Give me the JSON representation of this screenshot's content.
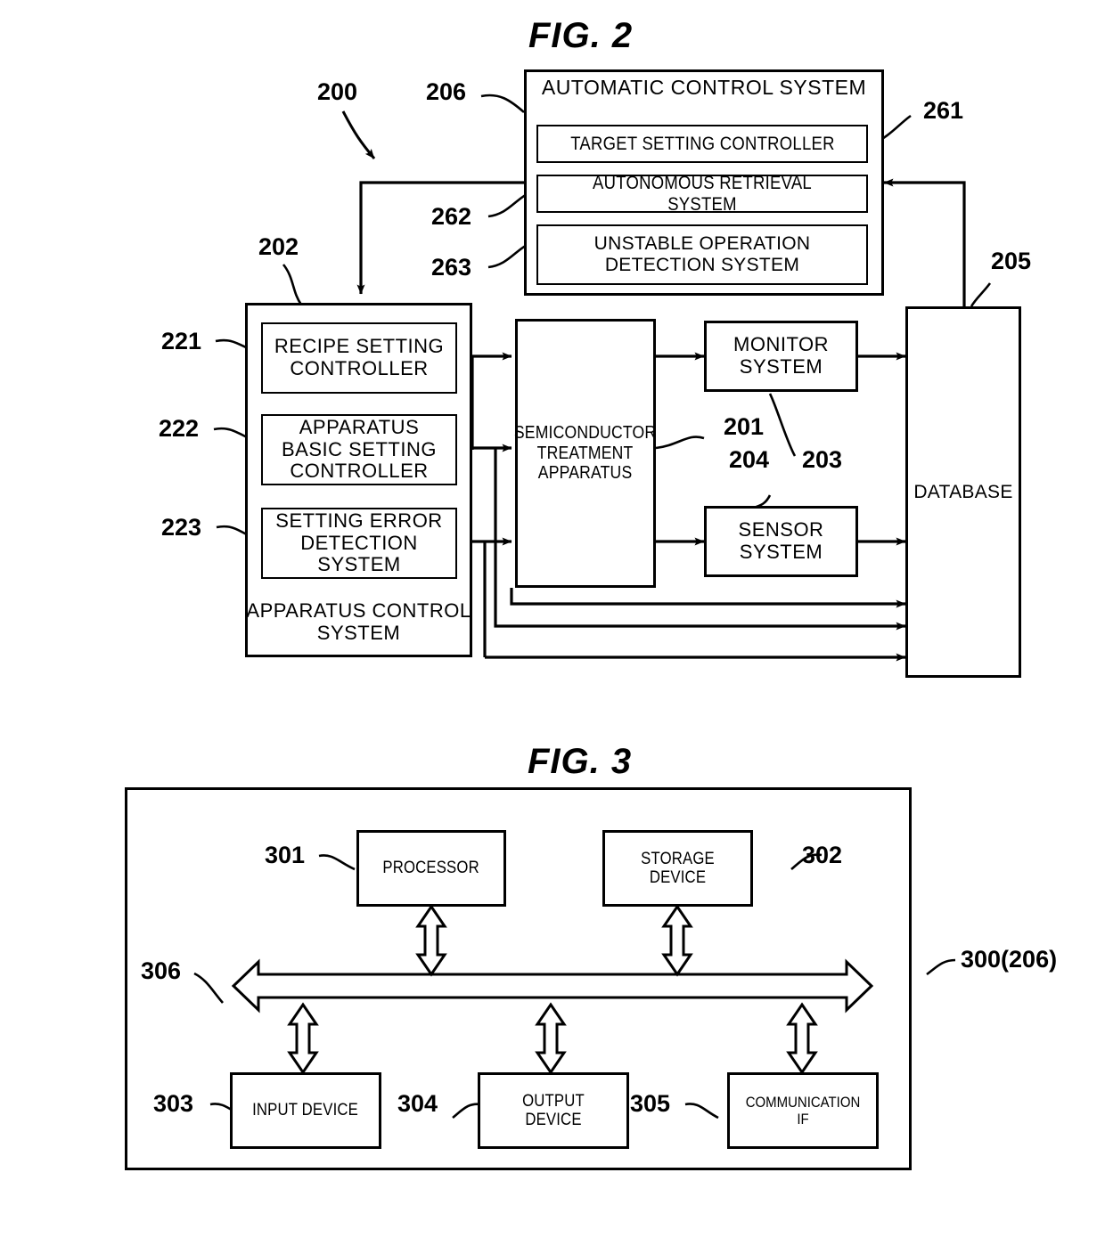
{
  "figures": [
    {
      "id": "fig2",
      "title": "FIG. 2",
      "refs": {
        "r200": "200",
        "r206": "206",
        "r261": "261",
        "r262": "262",
        "r263": "263",
        "r202": "202",
        "r221": "221",
        "r222": "222",
        "r223": "223",
        "r201": "201",
        "r203": "203",
        "r204": "204",
        "r205": "205"
      },
      "boxes": {
        "automatic_control_system": "AUTOMATIC CONTROL SYSTEM",
        "target_setting_controller": "TARGET SETTING CONTROLLER",
        "autonomous_retrieval_system": "AUTONOMOUS RETRIEVAL SYSTEM",
        "unstable_operation_detection_system": "UNSTABLE OPERATION DETECTION SYSTEM",
        "recipe_setting_controller": "RECIPE SETTING CONTROLLER",
        "apparatus_basic_setting_controller": "APPARATUS BASIC SETTING CONTROLLER",
        "setting_error_detection_system": "SETTING ERROR DETECTION SYSTEM",
        "apparatus_control_system": "APPARATUS CONTROL SYSTEM",
        "semiconductor_treatment_apparatus": "SEMICONDUCTOR TREATMENT APPARATUS",
        "monitor_system": "MONITOR SYSTEM",
        "sensor_system": "SENSOR SYSTEM",
        "database": "DATABASE"
      }
    },
    {
      "id": "fig3",
      "title": "FIG. 3",
      "refs": {
        "r301": "301",
        "r302": "302",
        "r303": "303",
        "r304": "304",
        "r305": "305",
        "r306": "306",
        "r300": "300(206)"
      },
      "boxes": {
        "processor": "PROCESSOR",
        "storage_device": "STORAGE DEVICE",
        "input_device": "INPUT DEVICE",
        "output_device": "OUTPUT DEVICE",
        "communication_if": "COMMUNICATION IF"
      }
    }
  ],
  "style": {
    "line_color": "#000000",
    "background": "#ffffff"
  }
}
